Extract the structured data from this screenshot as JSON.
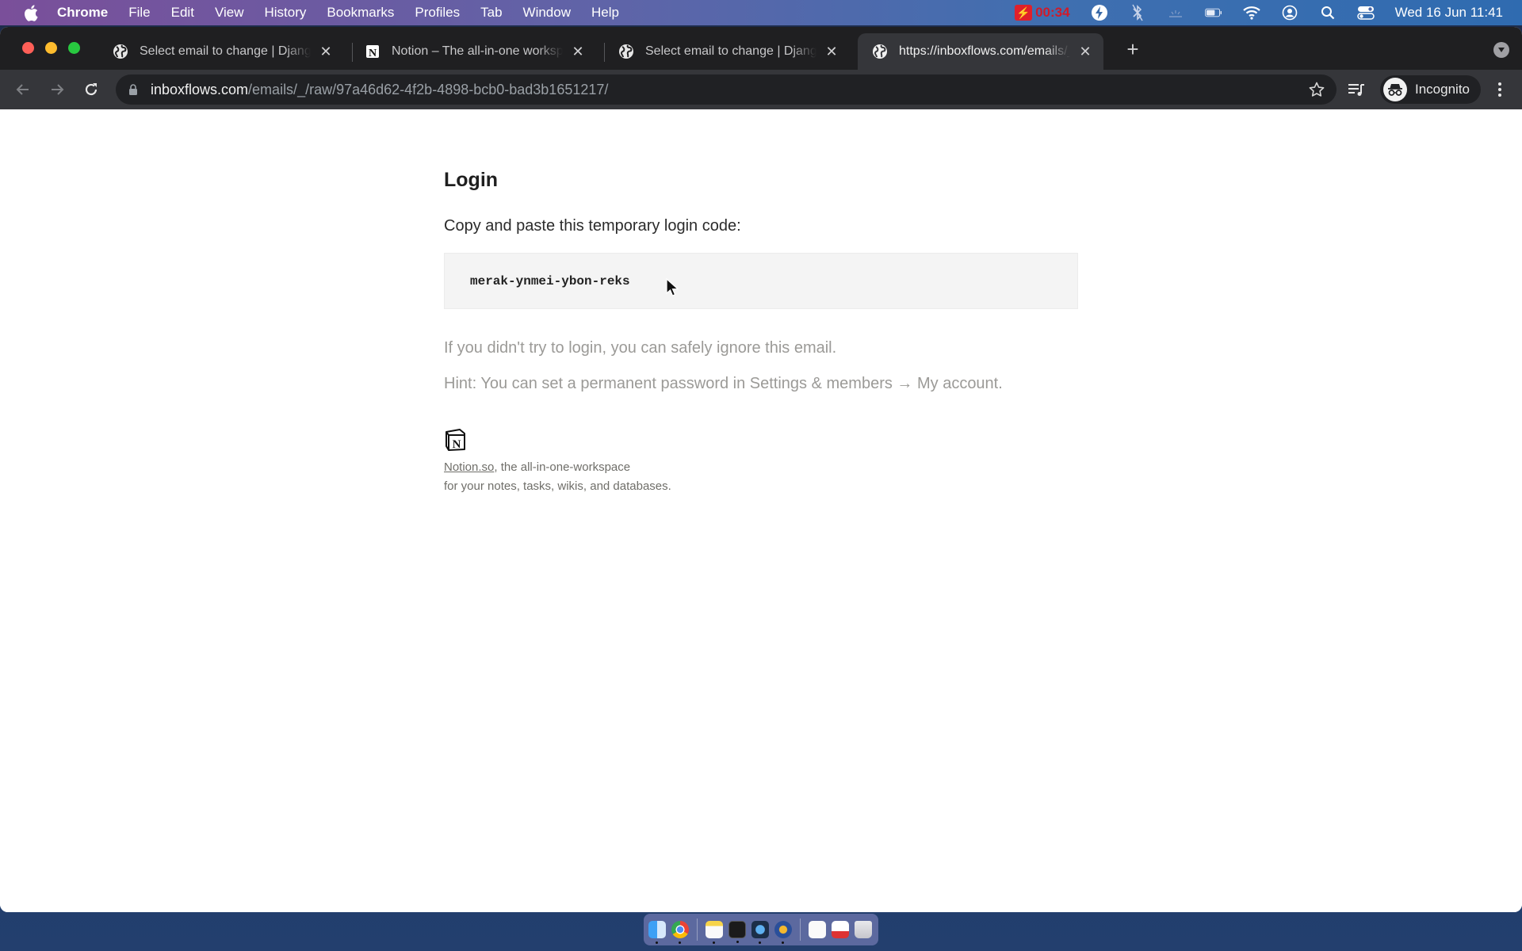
{
  "menubar": {
    "app_name": "Chrome",
    "items": [
      "File",
      "Edit",
      "View",
      "History",
      "Bookmarks",
      "Profiles",
      "Tab",
      "Window",
      "Help"
    ],
    "recording_time": "00:34",
    "clock": "Wed 16 Jun  11:41"
  },
  "browser": {
    "tabs": [
      {
        "title": "Select email to change | Django site admin",
        "icon": "globe-icon",
        "active": false
      },
      {
        "title": "Notion – The all-in-one workspace",
        "icon": "notion-icon",
        "active": false
      },
      {
        "title": "Select email to change | Django site admin",
        "icon": "globe-icon",
        "active": false
      },
      {
        "title": "https://inboxflows.com/emails/_/raw/",
        "icon": "globe-icon",
        "active": true
      }
    ],
    "url_host": "inboxflows.com",
    "url_path": "/emails/_/raw/97a46d62-4f2b-4898-bcb0-bad3b1651217/",
    "profile_label": "Incognito"
  },
  "email": {
    "heading": "Login",
    "lead": "Copy and paste this temporary login code:",
    "code": "merak-ynmei-ybon-reks",
    "ignore_note": "If you didn't try to login, you can safely ignore this email.",
    "hint": "Hint: You can set a permanent password in Settings & members → My account.",
    "footer_link": "Notion.so",
    "footer_line1_rest": ", the all-in-one-workspace",
    "footer_line2": "for your notes, tasks, wikis, and databases."
  },
  "dock": {
    "apps": [
      "Finder",
      "Chrome",
      "Notes",
      "Terminal",
      "QuickTime Player",
      "Reeder",
      "Document",
      "Screenshot",
      "Trash"
    ]
  }
}
